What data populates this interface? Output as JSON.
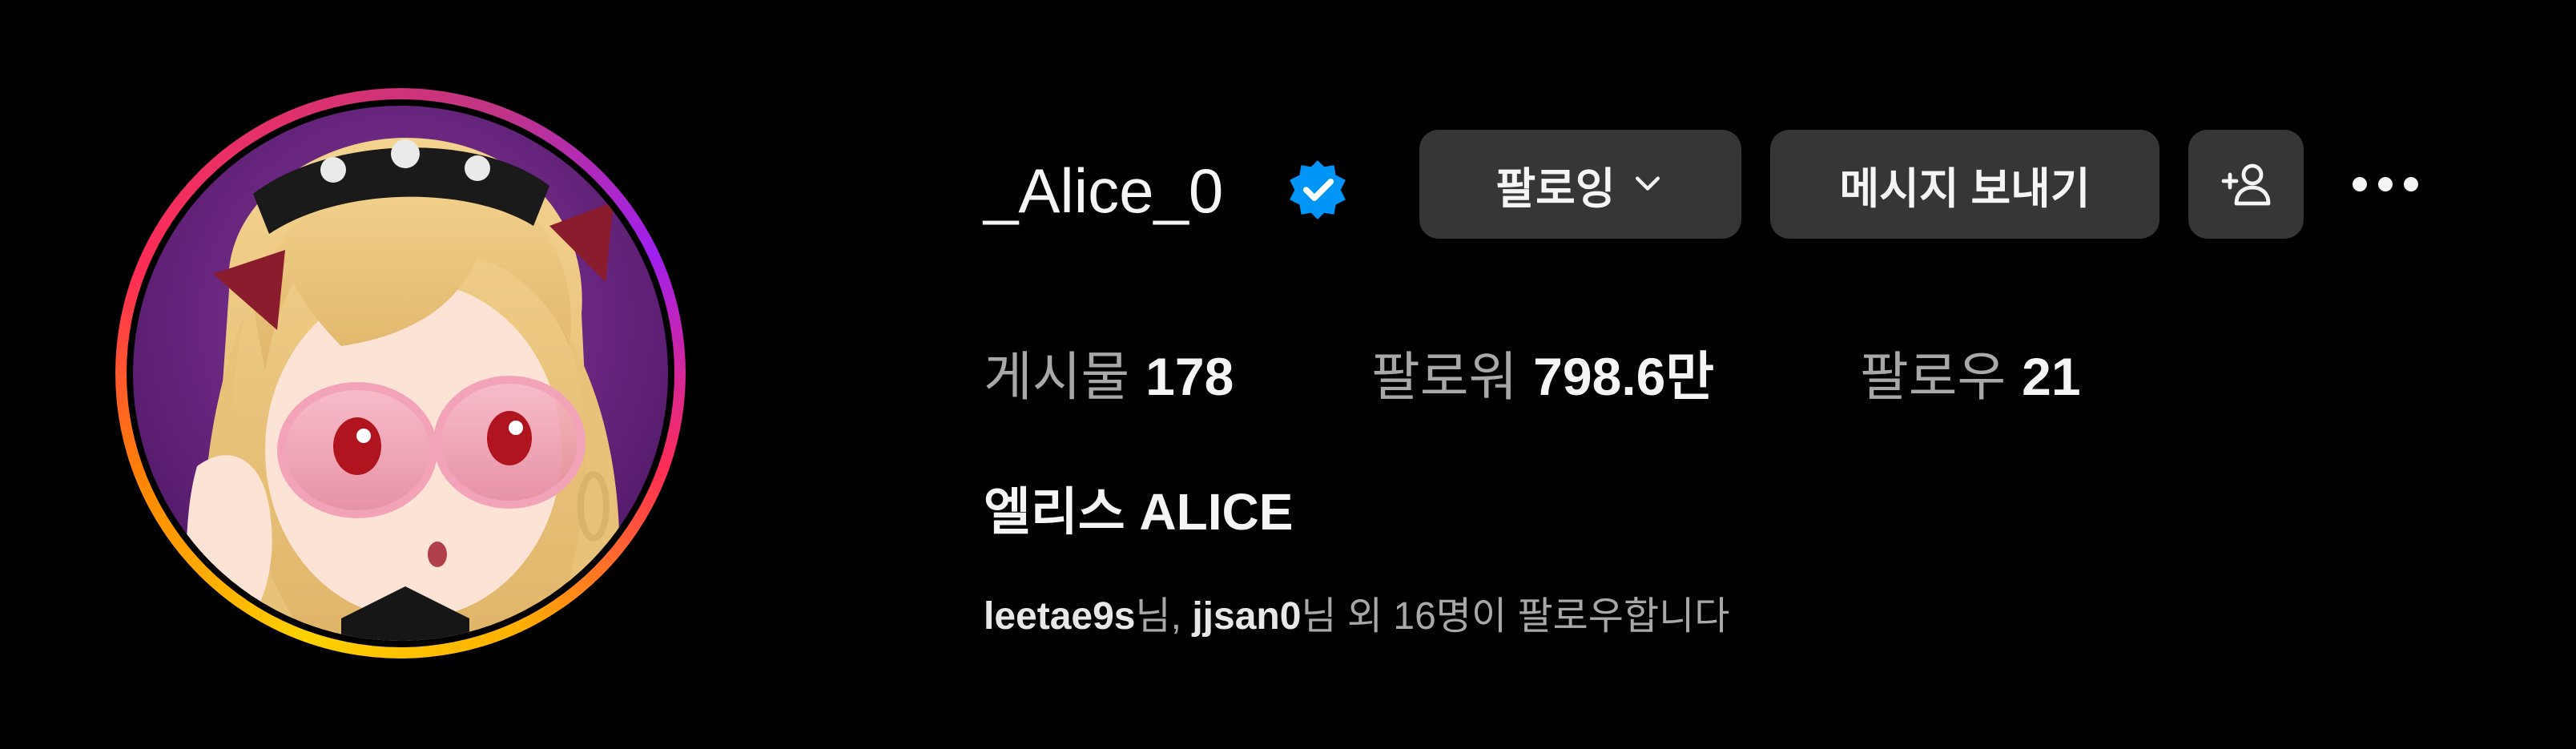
{
  "profile": {
    "username": "_Alice_0",
    "display_name": "엘리스 ALICE",
    "verified": true,
    "avatar": "anime-girl-with-pink-sunglasses",
    "story_ring_colors": [
      "#ffd200",
      "#ff8a00",
      "#ff2d55",
      "#c13584",
      "#a020f0"
    ]
  },
  "actions": {
    "follow_label": "팔로잉",
    "follow_chevron": "chevron-down-icon",
    "message_label": "메시지 보내기",
    "suggest_icon": "add-person-icon",
    "more_icon": "more-horizontal-icon"
  },
  "stats": {
    "posts_label": "게시물",
    "posts_value": "178",
    "followers_label": "팔로워",
    "followers_value": "798.6만",
    "following_label": "팔로우",
    "following_value": "21"
  },
  "followed_by": {
    "user1": "leetae9s",
    "suffix1": "님, ",
    "user2": "jjsan0",
    "suffix2": "님 외 16명이 팔로우합니다"
  },
  "colors": {
    "background": "#000000",
    "button_bg": "#363636",
    "text_primary": "#f5f5f5",
    "text_secondary": "#a8a8a8",
    "verified_blue": "#0095f6"
  }
}
